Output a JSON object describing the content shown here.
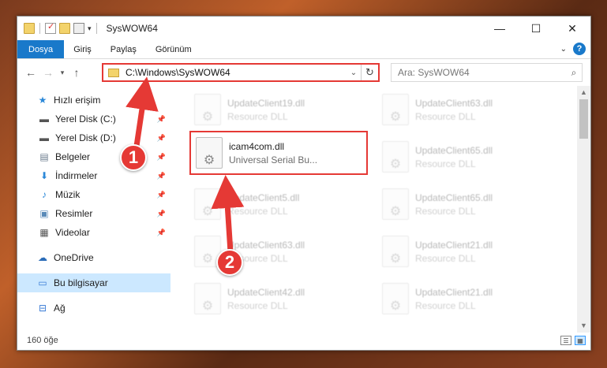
{
  "window": {
    "title": "SysWOW64",
    "controls": {
      "minimize": "—",
      "maximize": "☐",
      "close": "✕"
    }
  },
  "ribbon": {
    "tabs": [
      "Dosya",
      "Giriş",
      "Paylaş",
      "Görünüm"
    ],
    "help": "?"
  },
  "address": {
    "path": "C:\\Windows\\SysWOW64",
    "search_placeholder": "Ara: SysWOW64"
  },
  "nav": {
    "items": [
      {
        "label": "Hızlı erişim",
        "icon": "star-icon"
      },
      {
        "label": "Yerel Disk (C:)",
        "icon": "drive-icon",
        "pinned": true
      },
      {
        "label": "Yerel Disk (D:)",
        "icon": "drive-icon",
        "pinned": true
      },
      {
        "label": "Belgeler",
        "icon": "documents-icon",
        "pinned": true
      },
      {
        "label": "İndirmeler",
        "icon": "download-icon",
        "pinned": true
      },
      {
        "label": "Müzik",
        "icon": "music-icon",
        "pinned": true
      },
      {
        "label": "Resimler",
        "icon": "pictures-icon",
        "pinned": true
      },
      {
        "label": "Videolar",
        "icon": "videos-icon",
        "pinned": true
      },
      {
        "label": "OneDrive",
        "icon": "cloud-icon"
      },
      {
        "label": "Bu bilgisayar",
        "icon": "computer-icon",
        "selected": true
      },
      {
        "label": "Ağ",
        "icon": "network-icon"
      }
    ]
  },
  "files": {
    "highlighted": {
      "name": "icam4com.dll",
      "type": "Universal Serial Bu..."
    },
    "left_column": [
      {
        "name": "UpdateClient19.dll",
        "type": "Resource DLL"
      },
      {
        "name": "UpdateClient5.dll",
        "type": "Resource DLL"
      },
      {
        "name": "UpdateClient63.dll",
        "type": "Resource DLL"
      },
      {
        "name": "UpdateClient42.dll",
        "type": "Resource DLL"
      }
    ],
    "right_column": [
      {
        "name": "UpdateClient63.dll",
        "type": "Resource DLL"
      },
      {
        "name": "UpdateClient65.dll",
        "type": "Resource DLL"
      },
      {
        "name": "UpdateClient65.dll",
        "type": "Resource DLL"
      },
      {
        "name": "UpdateClient21.dll",
        "type": "Resource DLL"
      },
      {
        "name": "UpdateClient21.dll",
        "type": "Resource DLL"
      }
    ]
  },
  "status": {
    "count": "160 öğe"
  },
  "annotations": {
    "step1": "1",
    "step2": "2",
    "color": "#e53935"
  }
}
